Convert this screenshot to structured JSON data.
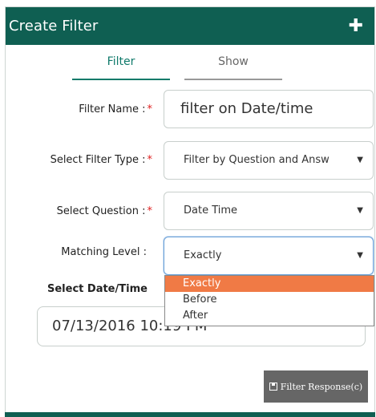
{
  "header": {
    "title": "Create Filter",
    "add_icon": "plus-icon"
  },
  "tabs": [
    {
      "label": "Filter",
      "active": true
    },
    {
      "label": "Show",
      "active": false
    }
  ],
  "form": {
    "filter_name": {
      "label": "Filter Name :",
      "required_mark": "*",
      "value": "filter on Date/time"
    },
    "filter_type": {
      "label": "Select Filter Type :",
      "required_mark": "*",
      "value": "Filter by Question and Answ"
    },
    "question": {
      "label": "Select Question :",
      "required_mark": "*",
      "value": "Date Time"
    },
    "matching_level": {
      "label": "Matching Level :",
      "value": "Exactly",
      "options": [
        "Exactly",
        "Before",
        "After"
      ]
    },
    "date_time": {
      "label": "Select Date/Time",
      "value": "07/13/2016 10:19 PM"
    }
  },
  "actions": {
    "filter_response_label": "Filter Response(c)",
    "save_icon": "save-icon"
  },
  "colors": {
    "header": "#0f5f52",
    "accent": "#0f7a6a",
    "selected_option": "#f07a45",
    "button": "#666666",
    "required": "#e02020"
  }
}
